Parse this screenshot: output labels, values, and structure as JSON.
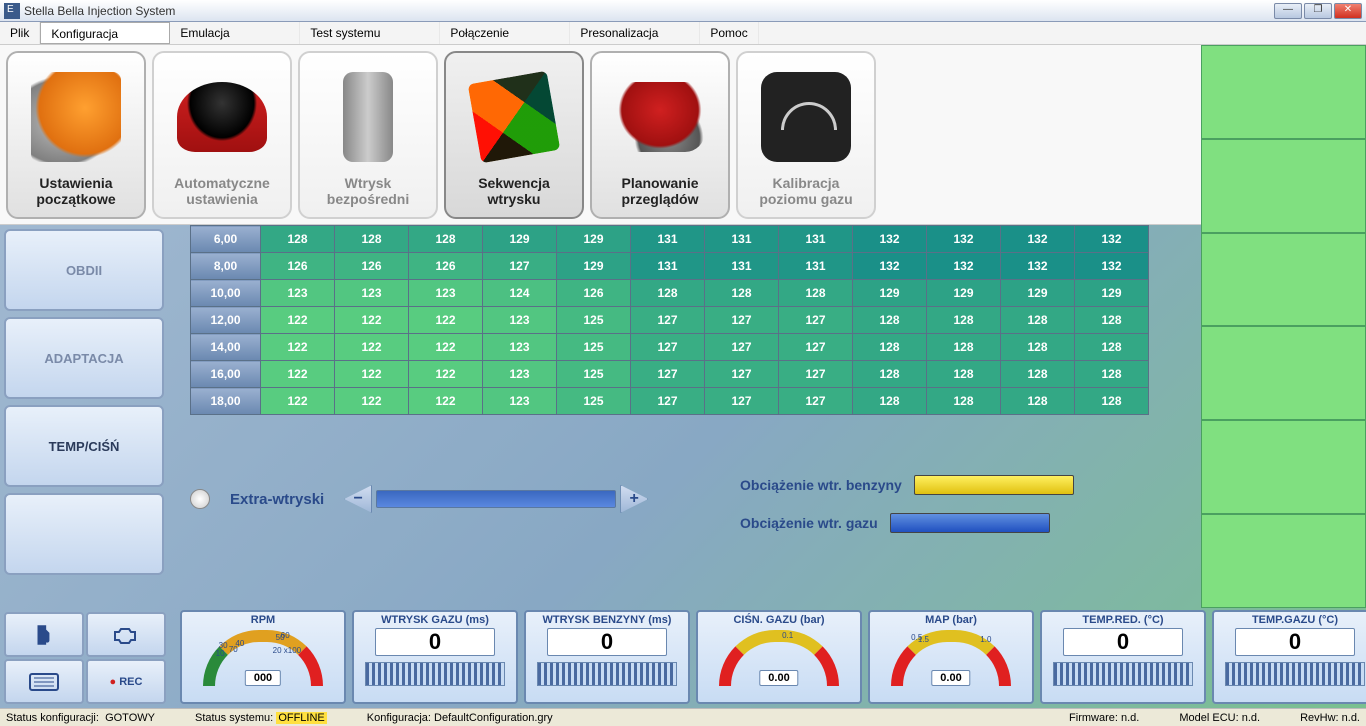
{
  "window": {
    "title": "Stella Bella Injection System"
  },
  "menu": [
    "Plik",
    "Konfiguracja",
    "Emulacja",
    "Test systemu",
    "Połączenie",
    "Presonalizacja",
    "Pomoc"
  ],
  "toolbar": [
    {
      "label": "Ustawienia początkowe",
      "name": "ustawienia-poczatkowe",
      "state": "active"
    },
    {
      "label": "Automatyczne ustawienia",
      "name": "automatyczne-ustawienia",
      "state": ""
    },
    {
      "label": "Wtrysk bezpośredni",
      "name": "wtrysk-bezposredni",
      "state": ""
    },
    {
      "label": "Sekwencja wtrysku",
      "name": "sekwencja-wtrysku",
      "state": "selected"
    },
    {
      "label": "Planowanie przeglądów",
      "name": "planowanie-przegladow",
      "state": "active"
    },
    {
      "label": "Kalibracja poziomu gazu",
      "name": "kalibracja-poziomu-gazu",
      "state": ""
    }
  ],
  "side_buttons": [
    "OBDII",
    "ADAPTACJA",
    "TEMP/CIŚŃ",
    ""
  ],
  "bottom_icons": {
    "rec": "REC"
  },
  "chart_data": {
    "type": "heatmap",
    "row_headers": [
      "6,00",
      "8,00",
      "10,00",
      "12,00",
      "14,00",
      "16,00",
      "18,00"
    ],
    "rows": [
      [
        128,
        128,
        128,
        129,
        129,
        131,
        131,
        131,
        132,
        132,
        132,
        132
      ],
      [
        126,
        126,
        126,
        127,
        129,
        131,
        131,
        131,
        132,
        132,
        132,
        132
      ],
      [
        123,
        123,
        123,
        124,
        126,
        128,
        128,
        128,
        129,
        129,
        129,
        129
      ],
      [
        122,
        122,
        122,
        123,
        125,
        127,
        127,
        127,
        128,
        128,
        128,
        128
      ],
      [
        122,
        122,
        122,
        123,
        125,
        127,
        127,
        127,
        128,
        128,
        128,
        128
      ],
      [
        122,
        122,
        122,
        123,
        125,
        127,
        127,
        127,
        128,
        128,
        128,
        128
      ],
      [
        122,
        122,
        122,
        123,
        125,
        127,
        127,
        127,
        128,
        128,
        128,
        128
      ]
    ],
    "value_min": 122,
    "value_max": 132,
    "color_low": "#58cc80",
    "color_high": "#1a9088"
  },
  "extra": {
    "label": "Extra-wtryski"
  },
  "load": {
    "benz_label": "Obciążenie wtr. benzyny",
    "gas_label": "Obciążenie wtr. gazu"
  },
  "gauges": [
    {
      "label": "RPM",
      "type": "arc",
      "num": "000",
      "ticks": [
        "10",
        "20",
        "30",
        "40",
        "x100",
        "50",
        "60",
        "70"
      ]
    },
    {
      "label": "WTRYSK GAZU (ms)",
      "type": "bar",
      "value": "0"
    },
    {
      "label": "WTRYSK BENZYNY (ms)",
      "type": "bar",
      "value": "0"
    },
    {
      "label": "CIŚN. GAZU (bar)",
      "type": "arc",
      "num": "0.00",
      "ticks": [
        "0.1"
      ]
    },
    {
      "label": "MAP (bar)",
      "type": "arc",
      "num": "0.00",
      "ticks": [
        "0.5",
        "1.0",
        "1.5"
      ]
    },
    {
      "label": "TEMP.RED. (°C)",
      "type": "bar",
      "value": "0"
    },
    {
      "label": "TEMP.GAZU (°C)",
      "type": "bar",
      "value": "0"
    }
  ],
  "status": {
    "config_lbl": "Status konfiguracji:",
    "config_val": "GOTOWY",
    "sys_lbl": "Status systemu:",
    "sys_val": "OFFLINE",
    "cfg_lbl": "Konfiguracja:",
    "cfg_val": "DefaultConfiguration.gry",
    "fw_lbl": "Firmware:",
    "fw_val": "n.d.",
    "ecu_lbl": "Model ECU:",
    "ecu_val": "n.d.",
    "rev_lbl": "RevHw:",
    "rev_val": "n.d."
  }
}
